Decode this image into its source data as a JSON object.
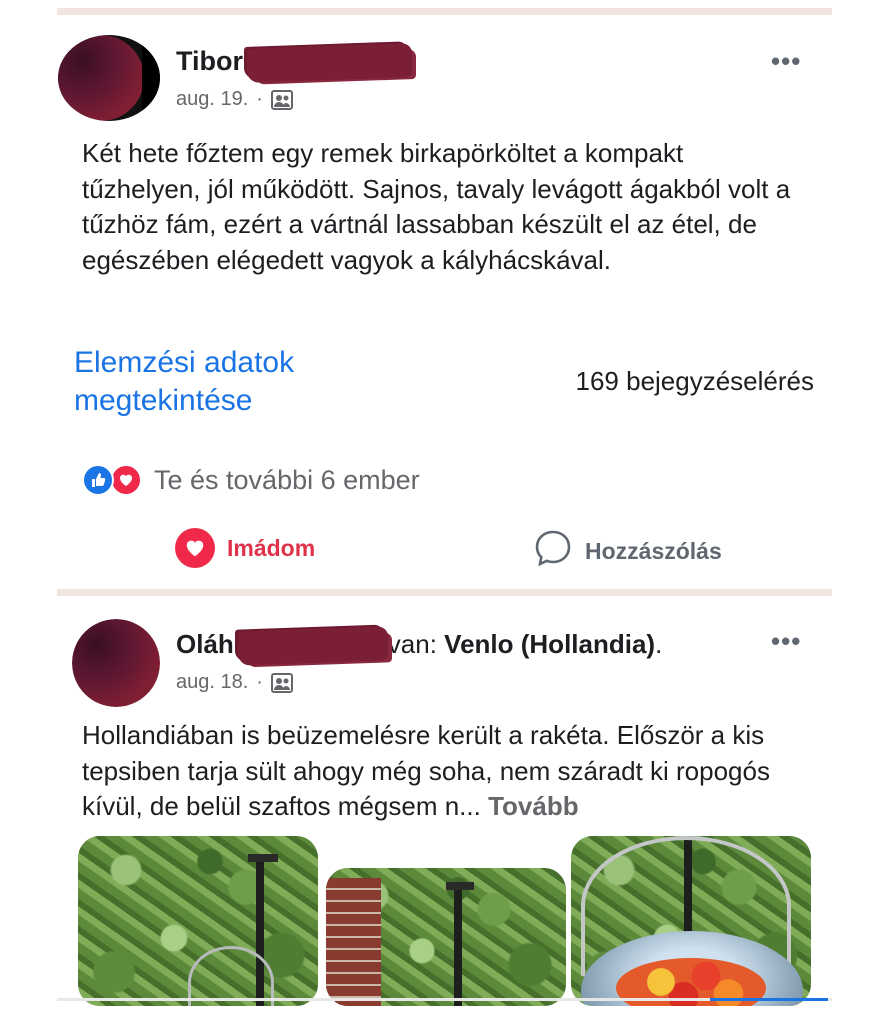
{
  "post1": {
    "author_first": "Tibor",
    "date": "aug. 19.",
    "separator": "·",
    "audience_icon": "friends-audience-icon",
    "more_icon": "more-dots-icon",
    "more_text": "•••",
    "text": "Két hete főztem egy remek birkapörköltet a kompakt tűzhelyen, jól működött. Sajnos, tavaly levágott ágakból volt a tűzhöz fám, ezért a vártnál lassabban készült el az étel, de egészében elégedett vagyok a kályhácskával.",
    "insights_link": "Elemzési adatok megtekintése",
    "reach": "169 bejegyzéselérés",
    "reactions_text": "Te és további 6 ember",
    "love_action": "Imádom",
    "comment_action": "Hozzászólás"
  },
  "post2": {
    "author_first": "Oláh",
    "location_prefix": "van: ",
    "location": "Venlo (Hollandia)",
    "location_suffix": ".",
    "date": "aug. 18.",
    "separator": "·",
    "more_text": "•••",
    "text": "Hollandiában is beüzemelésre került a rakéta. Először a kis tepsiben tarja sült ahogy még soha, nem száradt ki ropogós kívül, de belül szaftos mégsem n...",
    "more_link": "Tovább"
  },
  "colors": {
    "accent_blue": "#1b74e4",
    "love_red": "#f0284a",
    "divider": "#f2e4de",
    "redaction": "#7a1f36"
  }
}
